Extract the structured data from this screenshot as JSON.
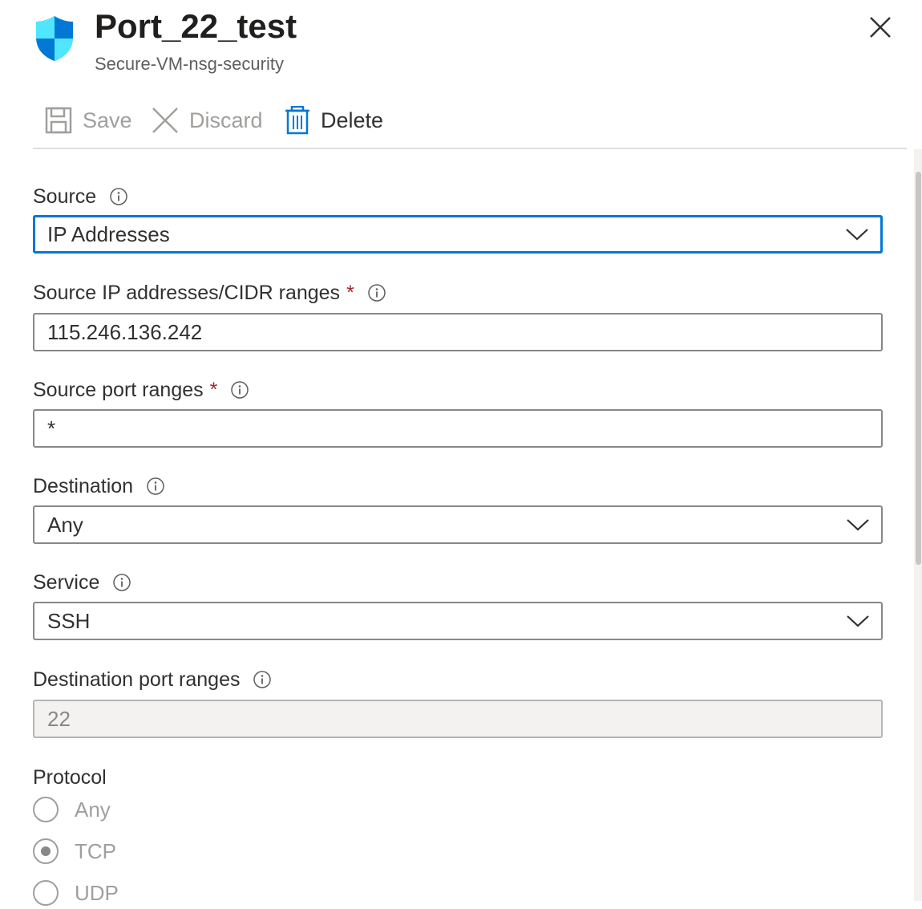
{
  "header": {
    "title": "Port_22_test",
    "subtitle": "Secure-VM-nsg-security",
    "icon": "shield-icon"
  },
  "toolbar": {
    "save_label": "Save",
    "discard_label": "Discard",
    "delete_label": "Delete"
  },
  "form": {
    "source": {
      "label": "Source",
      "value": "IP Addresses"
    },
    "source_ip": {
      "label": "Source IP addresses/CIDR ranges",
      "required": "*",
      "value": "115.246.136.242"
    },
    "source_port": {
      "label": "Source port ranges",
      "required": "*",
      "value": "*"
    },
    "destination": {
      "label": "Destination",
      "value": "Any"
    },
    "service": {
      "label": "Service",
      "value": "SSH"
    },
    "dest_port": {
      "label": "Destination port ranges",
      "value": "22"
    },
    "protocol": {
      "label": "Protocol",
      "options": [
        "Any",
        "TCP",
        "UDP"
      ],
      "selected": "TCP"
    }
  },
  "colors": {
    "accent": "#0078d4",
    "required": "#a4262c",
    "disabled_text": "#a19f9d"
  }
}
